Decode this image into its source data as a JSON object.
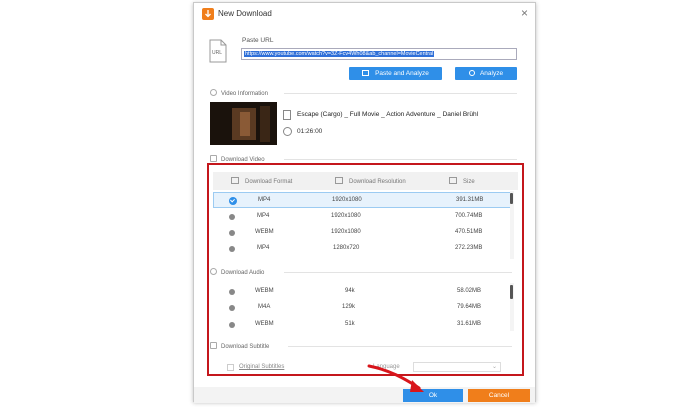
{
  "window": {
    "title": "New Download",
    "close_symbol": "×"
  },
  "url": {
    "label": "Paste URL",
    "value": "https://www.youtube.com/watch?v=3Z-Fcv4Wh08&ab_channel=MovieCentral"
  },
  "buttons": {
    "paste_analyze": "Paste and Analyze",
    "analyze": "Analyze",
    "ok": "Ok",
    "cancel": "Cancel"
  },
  "video_info": {
    "section_label": "Video Information",
    "title": "Escape (Cargo) _ Full Movie _ Action Adventure _ Daniel Brühl",
    "duration": "01:26:00"
  },
  "download_video": {
    "section_label": "Download Video",
    "columns": [
      "Download Format",
      "Download Resolution",
      "Size"
    ],
    "rows": [
      {
        "format": "MP4",
        "resolution": "1920x1080",
        "size": "391.31MB",
        "selected": true
      },
      {
        "format": "MP4",
        "resolution": "1920x1080",
        "size": "700.74MB",
        "selected": false
      },
      {
        "format": "WEBM",
        "resolution": "1920x1080",
        "size": "470.51MB",
        "selected": false
      },
      {
        "format": "MP4",
        "resolution": "1280x720",
        "size": "272.23MB",
        "selected": false
      }
    ]
  },
  "download_audio": {
    "section_label": "Download Audio",
    "rows": [
      {
        "format": "WEBM",
        "bitrate": "94k",
        "size": "58.02MB"
      },
      {
        "format": "M4A",
        "bitrate": "129k",
        "size": "79.64MB"
      },
      {
        "format": "WEBM",
        "bitrate": "51k",
        "size": "31.61MB"
      }
    ]
  },
  "download_subtitle": {
    "section_label": "Download Subtitle",
    "original_label": "Original Subtitles",
    "language_label": "Language",
    "language_value": ""
  },
  "colors": {
    "accent_blue": "#2f8fe8",
    "accent_orange": "#f07e1b",
    "highlight_red": "#c4171c"
  }
}
